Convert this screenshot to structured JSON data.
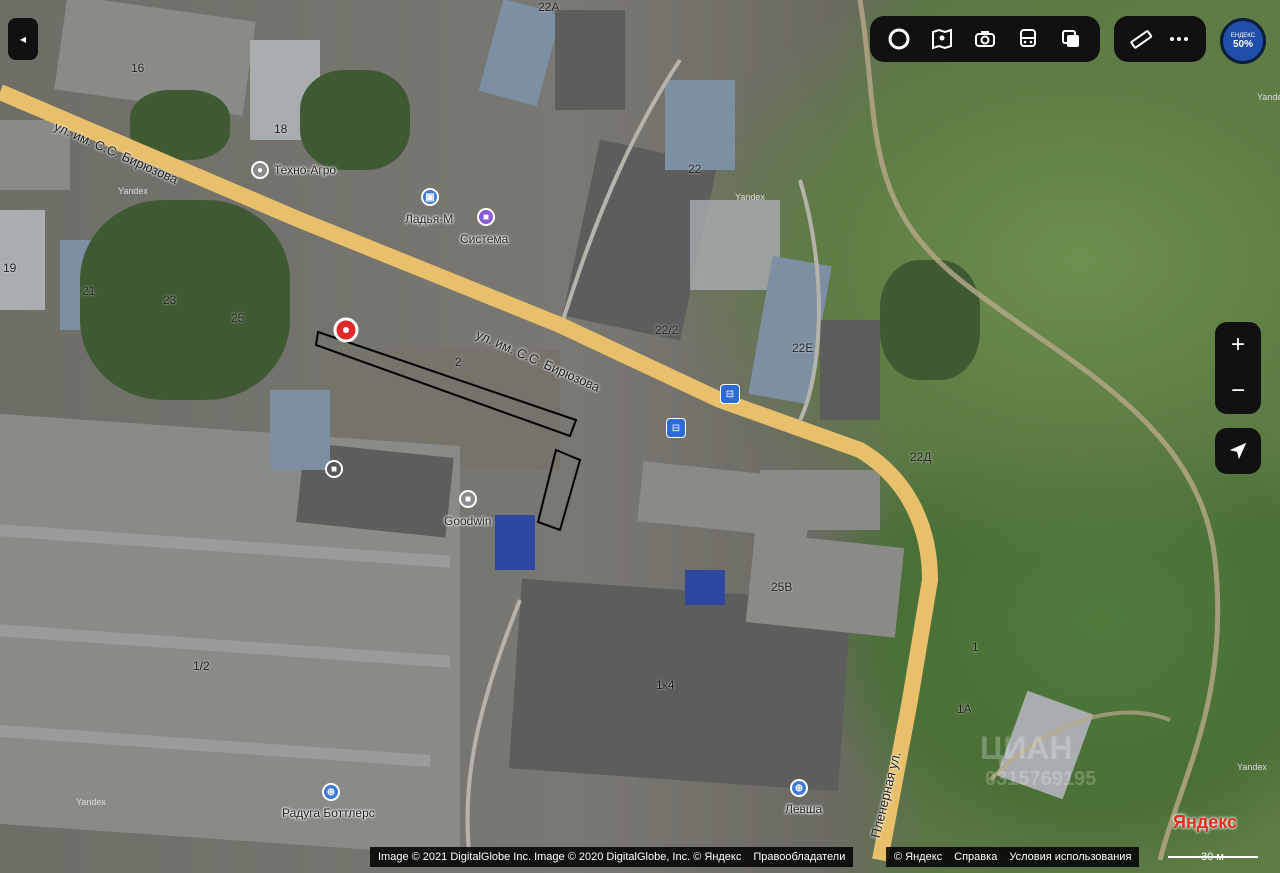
{
  "map": {
    "streets": [
      {
        "id": "s1",
        "label": "ул. им. С.С. Бирюзова"
      },
      {
        "id": "s2",
        "label": "ул. им. С.С. Бирюзова"
      },
      {
        "id": "s3",
        "label": "Пленерная ул."
      }
    ],
    "house_numbers": [
      "16",
      "18",
      "22",
      "19",
      "21",
      "23",
      "25",
      "2",
      "22/2",
      "22Е",
      "22Д",
      "25В",
      "1/2",
      "1к4",
      "1",
      "1А",
      "22А"
    ],
    "pois": [
      {
        "label": "Техно-Агро",
        "icon": "location-dot-icon",
        "color": "#8c8c8c"
      },
      {
        "label": "Ладья-М",
        "icon": "car-icon",
        "color": "#3d7bd8"
      },
      {
        "label": "Система",
        "icon": "briefcase-icon",
        "color": "#8a5bd6"
      },
      {
        "label": "Goodwin",
        "icon": "briefcase-icon",
        "color": "#8c8c8c"
      },
      {
        "label": "Радуга Боттлерс",
        "icon": "cart-icon",
        "color": "#3d7bd8"
      },
      {
        "label": "Левша",
        "icon": "cart-icon",
        "color": "#3d7bd8"
      }
    ],
    "tile_text": [
      "Yandex",
      "Yandex",
      "Yandex",
      "Yandex",
      "Yandex"
    ],
    "watermark": [
      "ЦИАН",
      "0315769195"
    ]
  },
  "controls": {
    "back": "◂",
    "toolbar_icons": [
      "layers-circle-icon",
      "map-book-icon",
      "panorama-camera-icon",
      "bus-icon",
      "layers-icon"
    ],
    "tools_icons": [
      "ruler-icon",
      "more-icon"
    ],
    "promo": {
      "top": "ЕНДЕКС",
      "value": "50%"
    },
    "zoom_in": "+",
    "zoom_out": "−"
  },
  "attribution": {
    "imagery": "Image © 2021 DigitalGlobe Inc. Image © 2020 DigitalGlobe, Inc. © Яндекс",
    "rights": "Правообладатели",
    "copyright": "© Яндекс",
    "help": "Справка",
    "terms": "Условия использования",
    "brand": "Яндекс",
    "scale": "30 м"
  },
  "colors": {
    "road": "#e8c06c",
    "marker": "#e02828",
    "transit": "#2d6bd6"
  }
}
